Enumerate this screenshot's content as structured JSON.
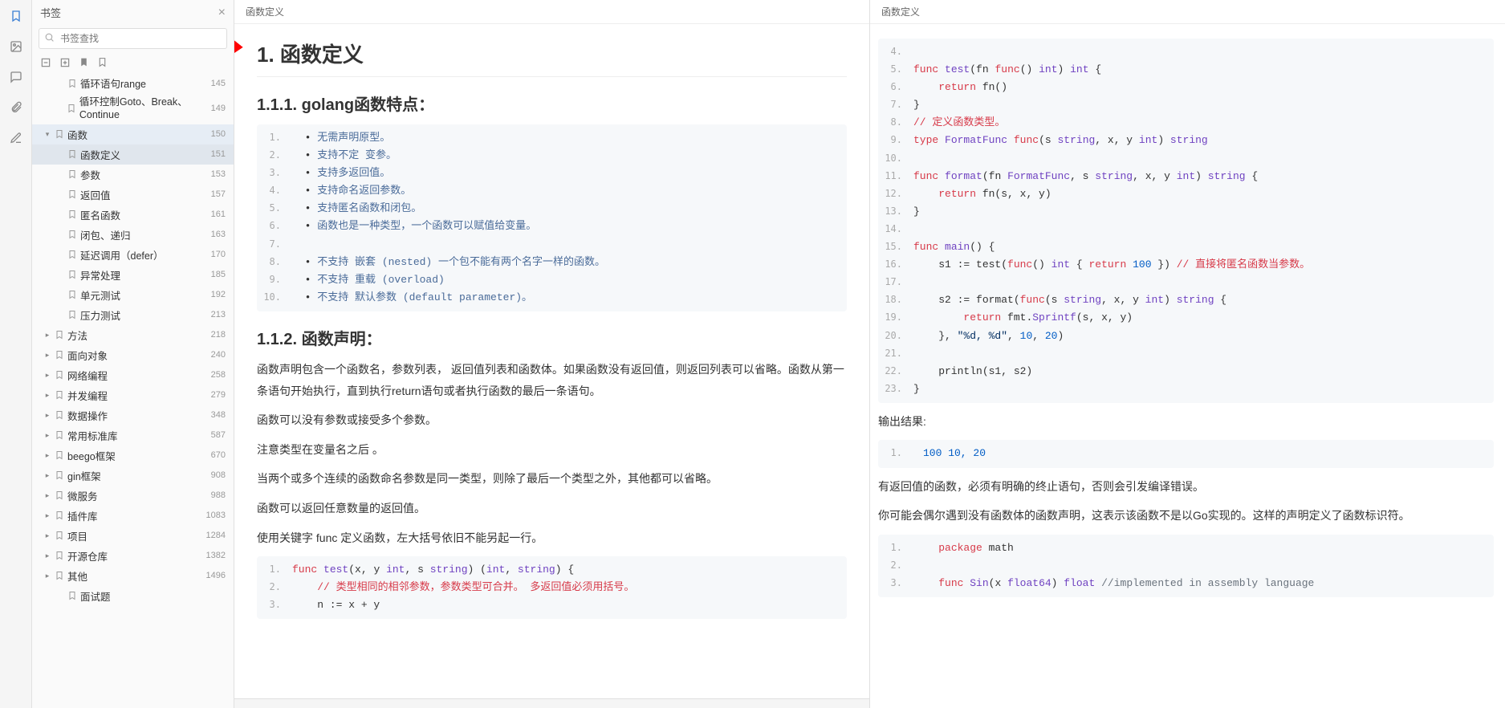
{
  "sidebar": {
    "title": "书签",
    "search_placeholder": "书签查找"
  },
  "tree": [
    {
      "depth": 1,
      "arrow": "",
      "label": "循环语句range",
      "page": "145"
    },
    {
      "depth": 1,
      "arrow": "",
      "label": "循环控制Goto、Break、Continue",
      "page": "149",
      "wrap": true
    },
    {
      "depth": 0,
      "arrow": "▾",
      "label": "函数",
      "page": "150",
      "selected": true
    },
    {
      "depth": 1,
      "arrow": "",
      "label": "函数定义",
      "page": "151",
      "active": true
    },
    {
      "depth": 1,
      "arrow": "",
      "label": "参数",
      "page": "153"
    },
    {
      "depth": 1,
      "arrow": "",
      "label": "返回值",
      "page": "157"
    },
    {
      "depth": 1,
      "arrow": "",
      "label": "匿名函数",
      "page": "161"
    },
    {
      "depth": 1,
      "arrow": "",
      "label": "闭包、递归",
      "page": "163"
    },
    {
      "depth": 1,
      "arrow": "",
      "label": "延迟调用（defer）",
      "page": "170"
    },
    {
      "depth": 1,
      "arrow": "",
      "label": "异常处理",
      "page": "185"
    },
    {
      "depth": 1,
      "arrow": "",
      "label": "单元测试",
      "page": "192"
    },
    {
      "depth": 1,
      "arrow": "",
      "label": "压力测试",
      "page": "213"
    },
    {
      "depth": 0,
      "arrow": "▸",
      "label": "方法",
      "page": "218"
    },
    {
      "depth": 0,
      "arrow": "▸",
      "label": "面向对象",
      "page": "240"
    },
    {
      "depth": 0,
      "arrow": "▸",
      "label": "网络编程",
      "page": "258"
    },
    {
      "depth": 0,
      "arrow": "▸",
      "label": "并发编程",
      "page": "279"
    },
    {
      "depth": 0,
      "arrow": "▸",
      "label": "数据操作",
      "page": "348"
    },
    {
      "depth": 0,
      "arrow": "▸",
      "label": "常用标准库",
      "page": "587"
    },
    {
      "depth": 0,
      "arrow": "▸",
      "label": "beego框架",
      "page": "670"
    },
    {
      "depth": 0,
      "arrow": "▸",
      "label": "gin框架",
      "page": "908"
    },
    {
      "depth": 0,
      "arrow": "▸",
      "label": "微服务",
      "page": "988"
    },
    {
      "depth": 0,
      "arrow": "▸",
      "label": "插件库",
      "page": "1083"
    },
    {
      "depth": 0,
      "arrow": "▸",
      "label": "项目",
      "page": "1284"
    },
    {
      "depth": 0,
      "arrow": "▸",
      "label": "开源仓库",
      "page": "1382"
    },
    {
      "depth": 0,
      "arrow": "▸",
      "label": "其他",
      "page": "1496"
    },
    {
      "depth": 1,
      "arrow": "",
      "label": "面试题",
      "page": ""
    }
  ],
  "left_pane": {
    "tab": "函数定义",
    "h1": "1. 函数定义",
    "h2a": "1.1.1. golang函数特点：",
    "features": [
      "无需声明原型。",
      "支持不定 变参。",
      "支持多返回值。",
      "支持命名返回参数。",
      "支持匿名函数和闭包。",
      "函数也是一种类型，一个函数可以赋值给变量。",
      "",
      "不支持 嵌套 (nested) 一个包不能有两个名字一样的函数。",
      "不支持 重载 (overload)",
      "不支持 默认参数 (default parameter)。"
    ],
    "h2b": "1.1.2. 函数声明：",
    "p1": "函数声明包含一个函数名，参数列表， 返回值列表和函数体。如果函数没有返回值，则返回列表可以省略。函数从第一条语句开始执行，直到执行return语句或者执行函数的最后一条语句。",
    "p2": "函数可以没有参数或接受多个参数。",
    "p3": "注意类型在变量名之后 。",
    "p4": "当两个或多个连续的函数命名参数是同一类型，则除了最后一个类型之外，其他都可以省略。",
    "p5": "函数可以返回任意数量的返回值。",
    "p6": "使用关键字 func 定义函数，左大括号依旧不能另起一行。"
  },
  "right_pane": {
    "tab": "函数定义",
    "out_label": "输出结果:",
    "out_val": "100 10, 20",
    "p_ret": "有返回值的函数，必须有明确的终止语句，否则会引发编译错误。",
    "p_nobody": "你可能会偶尔遇到没有函数体的函数声明，这表示该函数不是以Go实现的。这样的声明定义了函数标识符。"
  }
}
